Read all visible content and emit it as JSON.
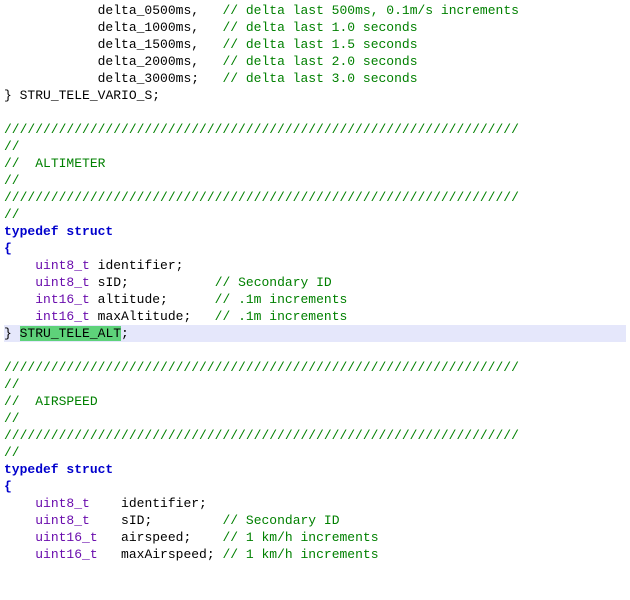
{
  "code": {
    "delta_fields": [
      {
        "name": "delta_0500ms",
        "term": ",",
        "comment": "// delta last 500ms, 0.1m/s increments"
      },
      {
        "name": "delta_1000ms",
        "term": ",",
        "comment": "// delta last 1.0 seconds"
      },
      {
        "name": "delta_1500ms",
        "term": ",",
        "comment": "// delta last 1.5 seconds"
      },
      {
        "name": "delta_2000ms",
        "term": ",",
        "comment": "// delta last 2.0 seconds"
      },
      {
        "name": "delta_3000ms",
        "term": ";",
        "comment": "// delta last 3.0 seconds"
      }
    ],
    "vario_close": {
      "brace": "}",
      "name": "STRU_TELE_VARIO_S",
      "semi": ";"
    },
    "sep_slashes": "//////////////////////////////////////////////////////////////////",
    "sep_empty": "//",
    "alt_header": {
      "prefix": "//  ",
      "title": "ALTIMETER"
    },
    "typedef_kw": "typedef",
    "struct_kw": "struct",
    "brace_open": "{",
    "brace_close": "}",
    "semi": ";",
    "alt_struct": {
      "fields": [
        {
          "type": "uint8_t",
          "name": "identifier;",
          "comment": ""
        },
        {
          "type": "uint8_t",
          "name": "sID;",
          "comment": "// Secondary ID"
        },
        {
          "type": "int16_t",
          "name": "altitude;",
          "comment": "// .1m increments"
        },
        {
          "type": "int16_t",
          "name": "maxAltitude;",
          "comment": "// .1m increments"
        }
      ],
      "close_name": "STRU_TELE_ALT"
    },
    "air_header": {
      "prefix": "//  ",
      "title": "AIRSPEED"
    },
    "air_struct": {
      "fields": [
        {
          "type": "uint8_t",
          "name": "identifier;",
          "comment": ""
        },
        {
          "type": "uint8_t",
          "name": "sID;",
          "comment": "// Secondary ID"
        },
        {
          "type": "uint16_t",
          "name": "airspeed;",
          "comment": "// 1 km/h increments"
        },
        {
          "type": "uint16_t",
          "name": "maxAirspeed;",
          "comment": "// 1 km/h increments"
        }
      ]
    }
  }
}
